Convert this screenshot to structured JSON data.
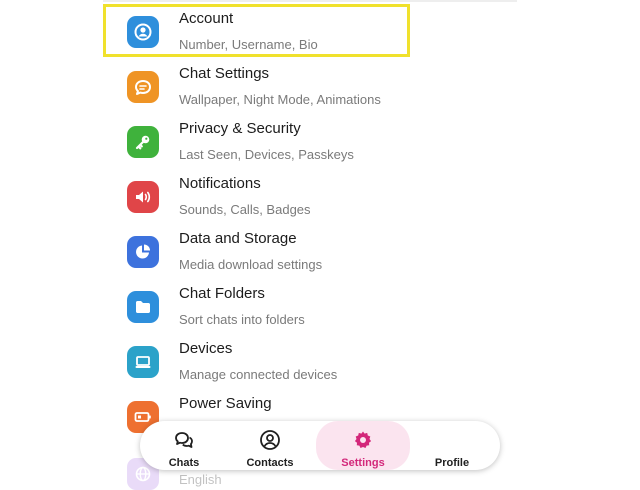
{
  "settings": {
    "items": [
      {
        "title": "Account",
        "subtitle": "Number, Username, Bio",
        "icon": "account-icon",
        "color": "#2e8fdc"
      },
      {
        "title": "Chat Settings",
        "subtitle": "Wallpaper, Night Mode, Animations",
        "icon": "chat-bubble-icon",
        "color": "#ef9425"
      },
      {
        "title": "Privacy & Security",
        "subtitle": "Last Seen, Devices, Passkeys",
        "icon": "key-icon",
        "color": "#3fb23c"
      },
      {
        "title": "Notifications",
        "subtitle": "Sounds, Calls, Badges",
        "icon": "speaker-icon",
        "color": "#e04548"
      },
      {
        "title": "Data and Storage",
        "subtitle": "Media download settings",
        "icon": "pie-chart-icon",
        "color": "#3d72dd"
      },
      {
        "title": "Chat Folders",
        "subtitle": "Sort chats into folders",
        "icon": "folder-icon",
        "color": "#2e8fdc"
      },
      {
        "title": "Devices",
        "subtitle": "Manage connected devices",
        "icon": "laptop-icon",
        "color": "#2ba2c9"
      },
      {
        "title": "Power Saving",
        "subtitle": "",
        "icon": "battery-icon",
        "color": "#ee7030"
      }
    ],
    "partial": {
      "title": "English",
      "icon": "globe-icon",
      "color": "#b07de6"
    }
  },
  "navbar": {
    "active": "Settings",
    "accent_color": "#d3277a",
    "items": [
      {
        "label": "Chats",
        "icon": "chats-icon"
      },
      {
        "label": "Contacts",
        "icon": "contacts-icon"
      },
      {
        "label": "Settings",
        "icon": "settings-gear-icon"
      },
      {
        "label": "Profile",
        "icon": "profile-icon"
      }
    ]
  },
  "highlight": {
    "target": "Account",
    "color": "#f0e12c"
  }
}
